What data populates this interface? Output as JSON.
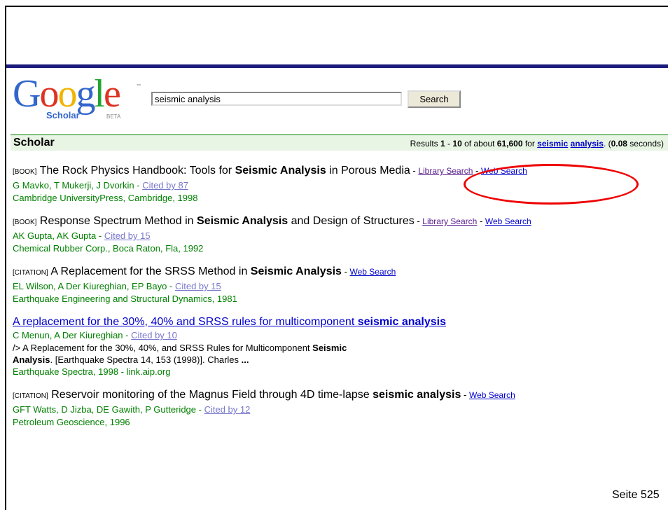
{
  "logo": {
    "word": "Google",
    "subtitle": "Scholar",
    "beta": "BETA",
    "tm": "™",
    "colors": [
      "#3366cc",
      "#dd3322",
      "#f0b400",
      "#3366cc",
      "#22a530",
      "#dd3322"
    ]
  },
  "search": {
    "value": "seismic analysis",
    "button_label": "Search"
  },
  "bar": {
    "title": "Scholar",
    "stats": {
      "prefix": "Results ",
      "start": "1",
      "dash": " - ",
      "end": "10",
      "mid": " of about ",
      "total": "61,600",
      "for": " for ",
      "q1": "seismic",
      "q2": "analysis",
      "dot": ". (",
      "time": "0.08",
      "suffix": " seconds)"
    }
  },
  "results": [
    {
      "tag": "[BOOK]",
      "title_pre": " The Rock Physics Handbook: Tools for ",
      "title_bold": "Seismic Analysis",
      "title_post": " in Porous Media",
      "links": [
        "Library Search",
        "Web Search"
      ],
      "authors": "G Mavko, T Mukerji, J Dvorkin",
      "cited": "Cited by 87",
      "source": "Cambridge UniversityPress, Cambridge, 1998"
    },
    {
      "tag": "[BOOK]",
      "title_pre": " Response Spectrum Method in ",
      "title_bold": "Seismic Analysis",
      "title_post": " and Design of Structures",
      "links": [
        "Library Search",
        "Web Search"
      ],
      "authors": "AK Gupta, AK Gupta",
      "cited": "Cited by 15",
      "source": "Chemical Rubber Corp., Boca Raton, Fla, 1992"
    },
    {
      "tag": "[CITATION]",
      "title_pre": " A Replacement for the SRSS Method in ",
      "title_bold": "Seismic Analysis",
      "title_post": "",
      "links": [
        "Web Search"
      ],
      "authors": "EL Wilson, A Der Kiureghian, EP Bayo",
      "cited": "Cited by 15",
      "source": "Earthquake Engineering and Structural Dynamics, 1981"
    },
    {
      "title_pre": "A replacement for the 30%, 40% and SRSS rules for multicomponent ",
      "title_bold": "seismic analysis",
      "authors": "C Menun, A Der Kiureghian",
      "cited": "Cited by 10",
      "snippet_1": "/> A Replacement for the 30%, 40%, and SRSS Rules for Multicomponent ",
      "snippet_1b": "Seismic",
      "snippet_2b": "Analysis",
      "snippet_2": ". [Earthquake Spectra 14, 153 (1998)]. Charles ",
      "snippet_ellipsis": "...",
      "source": "Earthquake Spectra, 1998 - link.aip.org"
    },
    {
      "tag": "[CITATION]",
      "title_pre": " Reservoir monitoring of the Magnus Field through 4D time-lapse ",
      "title_bold": "seismic analysis",
      "title_post": "",
      "links": [
        "Web Search"
      ],
      "authors": "GFT Watts, D Jizba, DE Gawith, P Gutteridge",
      "cited": "Cited by 12",
      "source": "Petroleum Geoscience, 1996"
    }
  ],
  "sep": " - ",
  "footer": {
    "text": "Seite 525"
  },
  "colors": {
    "annotation": "#e00000",
    "bar_border": "#008000",
    "header_rule": "#1c1c7c"
  }
}
